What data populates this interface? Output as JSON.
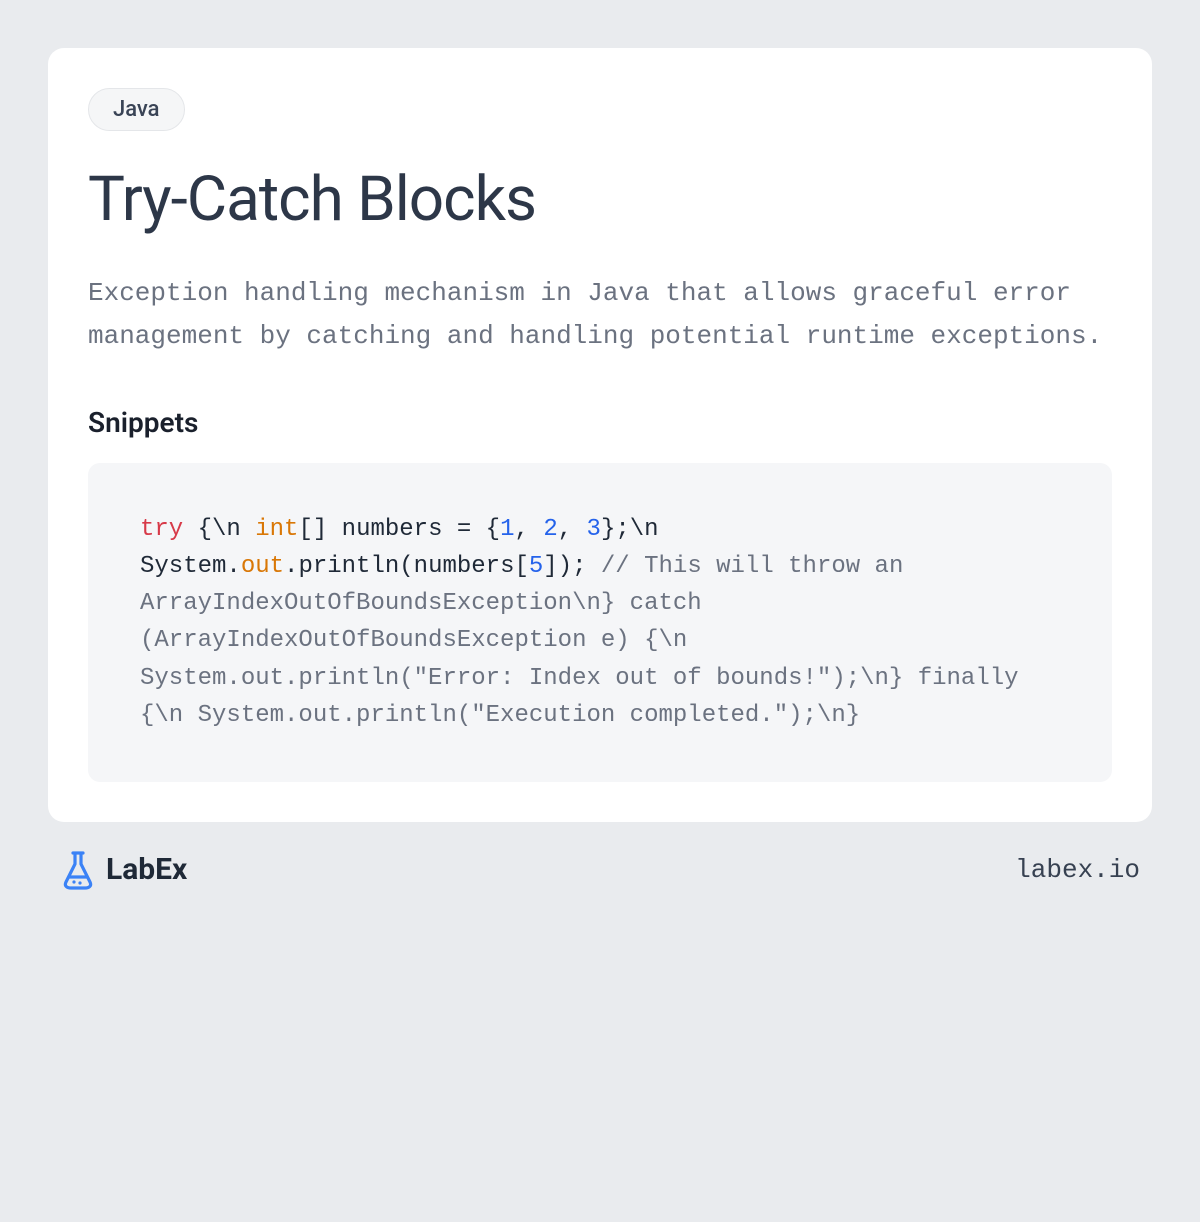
{
  "card": {
    "tag": "Java",
    "title": "Try-Catch Blocks",
    "description": "Exception handling mechanism in Java that allows graceful error management by catching and handling potential runtime exceptions.",
    "snippets_heading": "Snippets",
    "code_tokens": [
      {
        "t": "try",
        "c": "tok-keyword"
      },
      {
        "t": " {\\n    ",
        "c": "tok-plain"
      },
      {
        "t": "int",
        "c": "tok-type"
      },
      {
        "t": "[] numbers = {",
        "c": "tok-plain"
      },
      {
        "t": "1",
        "c": "tok-num"
      },
      {
        "t": ", ",
        "c": "tok-plain"
      },
      {
        "t": "2",
        "c": "tok-num"
      },
      {
        "t": ", ",
        "c": "tok-plain"
      },
      {
        "t": "3",
        "c": "tok-num"
      },
      {
        "t": "};\\n    System.",
        "c": "tok-plain"
      },
      {
        "t": "out",
        "c": "tok-out"
      },
      {
        "t": ".println(numbers[",
        "c": "tok-plain"
      },
      {
        "t": "5",
        "c": "tok-num"
      },
      {
        "t": "]); ",
        "c": "tok-plain"
      },
      {
        "t": "// This will throw an ArrayIndexOutOfBoundsException\\n} catch (ArrayIndexOutOfBoundsException e) {\\n    System.out.println(\"Error: Index out of bounds!\");\\n} finally {\\n    System.out.println(\"Execution completed.\");\\n}",
        "c": "tok-comment"
      }
    ]
  },
  "footer": {
    "brand": "LabEx",
    "url": "labex.io"
  },
  "colors": {
    "page_bg": "#e9ebee",
    "card_bg": "#ffffff",
    "tag_bg": "#f5f6f7",
    "code_bg": "#f5f6f8",
    "title": "#2d3748",
    "muted": "#6b7280",
    "keyword": "#d73a49",
    "type": "#d97706",
    "number": "#2563eb",
    "logo": "#3b82f6"
  }
}
